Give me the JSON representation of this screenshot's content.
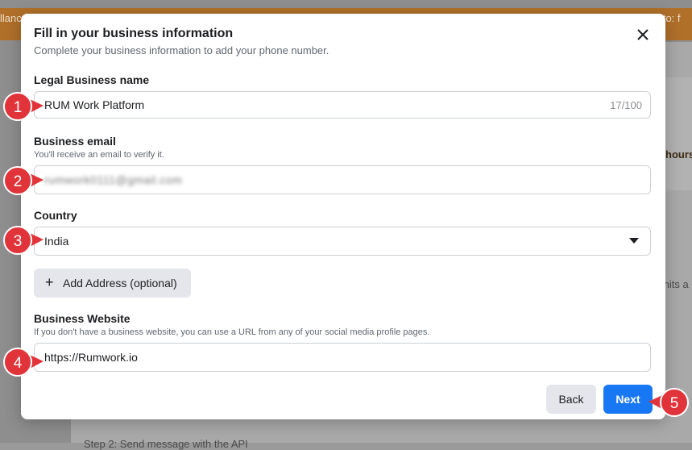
{
  "dialog": {
    "title": "Fill in your business information",
    "subtitle": "Complete your business information to add your phone number."
  },
  "fields": {
    "legal_name": {
      "label": "Legal Business name",
      "value": "RUM Work Platform",
      "counter": "17/100"
    },
    "email": {
      "label": "Business email",
      "hint": "You'll receive an email to verify it.",
      "value": "rumwork0111@gmail.com"
    },
    "country": {
      "label": "Country",
      "value": "India"
    },
    "website": {
      "label": "Business Website",
      "hint": "If you don't have a business website, you can use a URL from any of your social media profile pages.",
      "value": "https://Rumwork.io"
    }
  },
  "buttons": {
    "add_address": "Add Address (optional)",
    "back": "Back",
    "next": "Next"
  },
  "markers": [
    "1",
    "2",
    "3",
    "4",
    "5"
  ],
  "background": {
    "banner_left": "llanc",
    "banner_right": "e to: f",
    "card_text": "hours",
    "side_text": "mits a",
    "footer_text": "Step 2: Send message with the API"
  },
  "colors": {
    "primary": "#1877f2",
    "marker": "#e0343a",
    "banner": "#b0702a"
  }
}
